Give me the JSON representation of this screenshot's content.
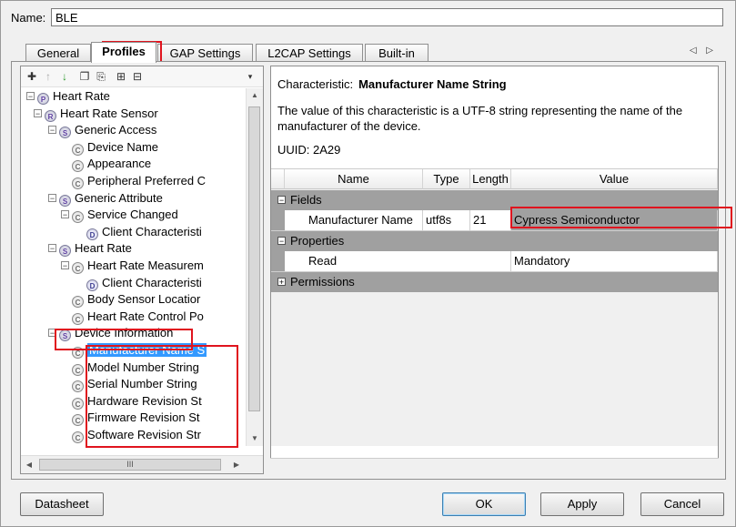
{
  "dialog": {
    "name_label": "Name:",
    "name_value": "BLE"
  },
  "tabs": [
    {
      "label": "General"
    },
    {
      "label": "Profiles"
    },
    {
      "label": "GAP Settings"
    },
    {
      "label": "L2CAP Settings"
    },
    {
      "label": "Built-in"
    }
  ],
  "tab_scroll": "◁ ▷",
  "tree": [
    {
      "label": "Heart Rate",
      "icon": "P",
      "expanded": true
    },
    {
      "label": "Heart Rate Sensor",
      "icon": "R",
      "expanded": true
    },
    {
      "label": "Generic Access",
      "icon": "S",
      "expanded": true
    },
    {
      "label": "Device Name",
      "icon": "C"
    },
    {
      "label": "Appearance",
      "icon": "C"
    },
    {
      "label": "Peripheral Preferred C",
      "icon": "C"
    },
    {
      "label": "Generic Attribute",
      "icon": "S",
      "expanded": true
    },
    {
      "label": "Service Changed",
      "icon": "C",
      "expanded": true
    },
    {
      "label": "Client Characteristi",
      "icon": "D"
    },
    {
      "label": "Heart Rate",
      "icon": "S",
      "expanded": true
    },
    {
      "label": "Heart Rate Measurem",
      "icon": "C",
      "expanded": true
    },
    {
      "label": "Client Characteristi",
      "icon": "D"
    },
    {
      "label": "Body Sensor Locatior",
      "icon": "C"
    },
    {
      "label": "Heart Rate Control Po",
      "icon": "C"
    },
    {
      "label": "Device Information",
      "icon": "S",
      "expanded": true
    },
    {
      "label": "Manufacturer Name S",
      "icon": "C",
      "selected": true
    },
    {
      "label": "Model Number String",
      "icon": "C"
    },
    {
      "label": "Serial Number String",
      "icon": "C"
    },
    {
      "label": "Hardware Revision St",
      "icon": "C"
    },
    {
      "label": "Firmware Revision St",
      "icon": "C"
    },
    {
      "label": "Software Revision Str",
      "icon": "C"
    }
  ],
  "hscroll_thumb": "III",
  "detail": {
    "characteristic_label": "Characteristic:",
    "characteristic_name": "Manufacturer Name String",
    "description": "The value of this characteristic is a UTF-8 string representing the name of the manufacturer of the device.",
    "uuid": "UUID: 2A29",
    "columns": [
      "Name",
      "Type",
      "Length",
      "Value"
    ],
    "sections": {
      "fields": "Fields",
      "properties": "Properties",
      "permissions": "Permissions"
    },
    "field_row": {
      "name": "Manufacturer Name",
      "type": "utf8s",
      "length": "21",
      "value": "Cypress Semiconductor"
    },
    "property_row": {
      "name": "Read",
      "value": "Mandatory"
    }
  },
  "buttons": {
    "datasheet": "Datasheet",
    "ok": "OK",
    "apply": "Apply",
    "cancel": "Cancel"
  },
  "colors": {
    "highlight": "#e0141e",
    "selection": "#3399ff",
    "category_row": "#a0a0a0"
  }
}
